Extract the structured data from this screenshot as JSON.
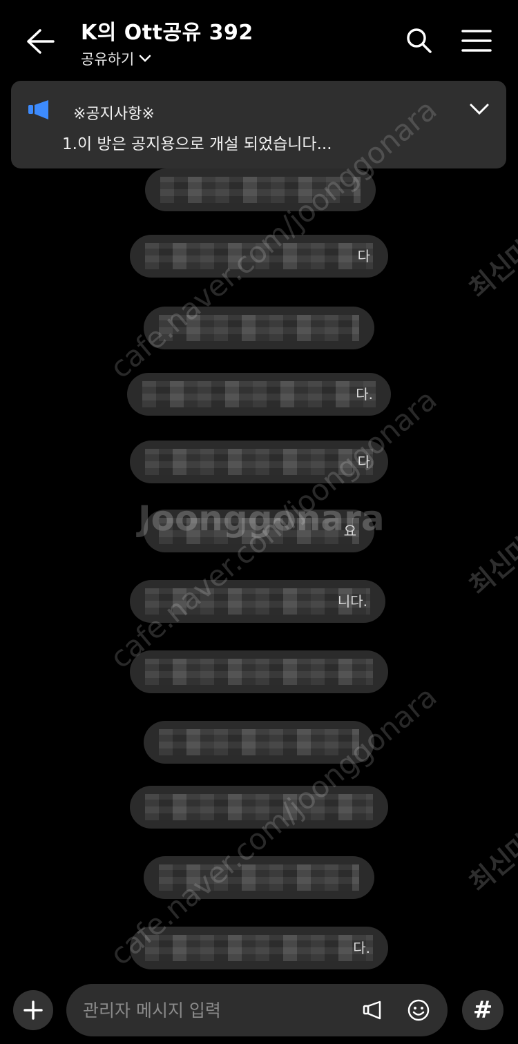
{
  "header": {
    "title": "K의 Ott공유 392",
    "subtitle": "공유하기"
  },
  "notice": {
    "head": "※공지사항※",
    "body": "1.이 방은 공지용으로 개설 되었습니다..."
  },
  "messages": [
    {
      "text": ""
    },
    {
      "text": "다"
    },
    {
      "text": ""
    },
    {
      "text": "다."
    },
    {
      "text": "다"
    },
    {
      "text": "요"
    },
    {
      "text": "니다."
    },
    {
      "text": ""
    },
    {
      "text": ""
    },
    {
      "text": ""
    },
    {
      "text": ""
    },
    {
      "text": "다."
    }
  ],
  "watermarks": {
    "site": "cafe.naver.com/joonggonara",
    "brand": "Joonggonara",
    "side": "최신마"
  },
  "input": {
    "placeholder": "관리자 메시지 입력"
  },
  "hash_label": "#",
  "colors": {
    "background": "#000000",
    "notice_bg": "#2f2f2f",
    "bubble_bg": "#2b2b2b",
    "accent_blue": "#3d8bfd"
  }
}
